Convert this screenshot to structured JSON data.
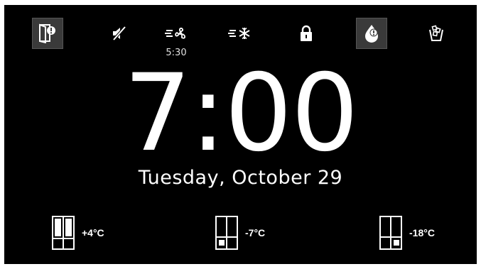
{
  "status_bar": {
    "icons": [
      {
        "name": "door-alert-icon",
        "highlighted": true
      },
      {
        "name": "sound-muted-icon",
        "highlighted": false
      },
      {
        "name": "fan-timer-icon",
        "highlighted": false,
        "sub_label": "5:30"
      },
      {
        "name": "fast-freeze-icon",
        "highlighted": false
      },
      {
        "name": "lock-icon",
        "highlighted": false
      },
      {
        "name": "water-filter-alert-icon",
        "highlighted": true
      },
      {
        "name": "ice-cup-icon",
        "highlighted": false
      }
    ]
  },
  "clock": {
    "time": "7:00",
    "date": "Tuesday, October 29"
  },
  "zones": [
    {
      "name": "fridge-zone-icon",
      "temperature": "+4°C"
    },
    {
      "name": "convertible-zone-icon",
      "temperature": "-7°C"
    },
    {
      "name": "freezer-zone-icon",
      "temperature": "-18°C"
    }
  ],
  "colors": {
    "background": "#000000",
    "foreground": "#ffffff",
    "highlight_box": "#3a3a3a"
  }
}
